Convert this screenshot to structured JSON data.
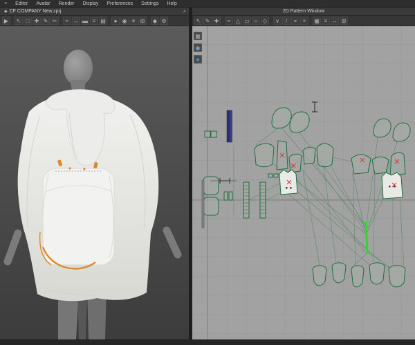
{
  "menubar": {
    "items": [
      "Editor",
      "Avatar",
      "Render",
      "Display",
      "Preferences",
      "Settings",
      "Help"
    ],
    "app_icon_glyph": "≡"
  },
  "left_window": {
    "title": "CF COMPANY  New.zprj",
    "icon_glyph": "◆",
    "maximize_glyph": "↗"
  },
  "right_window": {
    "title": "2D Pattern Window"
  },
  "toolbar_3d": {
    "icons": [
      {
        "name": "simulate",
        "glyph": "▶"
      },
      {
        "sep": true
      },
      {
        "name": "select-move",
        "glyph": "↖"
      },
      {
        "name": "box-select",
        "glyph": "□"
      },
      {
        "name": "pin",
        "glyph": "✚"
      },
      {
        "name": "brush",
        "glyph": "✎"
      },
      {
        "name": "scissors",
        "glyph": "✂"
      },
      {
        "sep": true
      },
      {
        "name": "sewing",
        "glyph": "≈"
      },
      {
        "name": "measure",
        "glyph": "↔"
      },
      {
        "name": "tape",
        "glyph": "▬"
      },
      {
        "name": "zipper",
        "glyph": "≡"
      },
      {
        "name": "fold-arrange",
        "glyph": "▤"
      },
      {
        "sep": true
      },
      {
        "name": "avatar",
        "glyph": "●"
      },
      {
        "name": "camera",
        "glyph": "◉"
      },
      {
        "name": "light",
        "glyph": "☀"
      },
      {
        "name": "grid",
        "glyph": "⊞"
      },
      {
        "sep": true
      },
      {
        "name": "render",
        "glyph": "◆"
      },
      {
        "name": "settings",
        "glyph": "⚙"
      }
    ]
  },
  "toolbar_2d": {
    "icons": [
      {
        "name": "transform-pattern",
        "glyph": "↖"
      },
      {
        "name": "edit-pattern",
        "glyph": "✎"
      },
      {
        "name": "add-point",
        "glyph": "✚"
      },
      {
        "sep": true
      },
      {
        "name": "edit-curvature",
        "glyph": "≈"
      },
      {
        "name": "polygon",
        "glyph": "△"
      },
      {
        "name": "rectangle",
        "glyph": "▭"
      },
      {
        "name": "circle",
        "glyph": "○"
      },
      {
        "name": "dart",
        "glyph": "◇"
      },
      {
        "sep": true
      },
      {
        "name": "notch",
        "glyph": "∨"
      },
      {
        "name": "seam-free",
        "glyph": "/"
      },
      {
        "name": "seam-segment",
        "glyph": "="
      },
      {
        "name": "show-seam",
        "glyph": "×"
      },
      {
        "sep": true
      },
      {
        "name": "texture-editor",
        "glyph": "▦"
      },
      {
        "name": "grading",
        "glyph": "≡"
      },
      {
        "name": "measure-2d",
        "glyph": "↔"
      },
      {
        "name": "grid-snap",
        "glyph": "⊞"
      }
    ]
  },
  "side_toolbar": {
    "icons": [
      {
        "name": "view-cube",
        "glyph": "▦",
        "color": "#a9a9a9"
      },
      {
        "name": "zoom-extents",
        "glyph": "◉",
        "color": "#7fa3d4"
      },
      {
        "name": "sync-2d3d",
        "glyph": "■",
        "color": "#4f86c6"
      }
    ]
  },
  "colors": {
    "pattern_green": "#1f6f3e",
    "selected_green": "#35d435",
    "accent_orange": "#d98a2c",
    "navy_strip": "#2c2e6e",
    "red_mark": "#cf3a34"
  }
}
